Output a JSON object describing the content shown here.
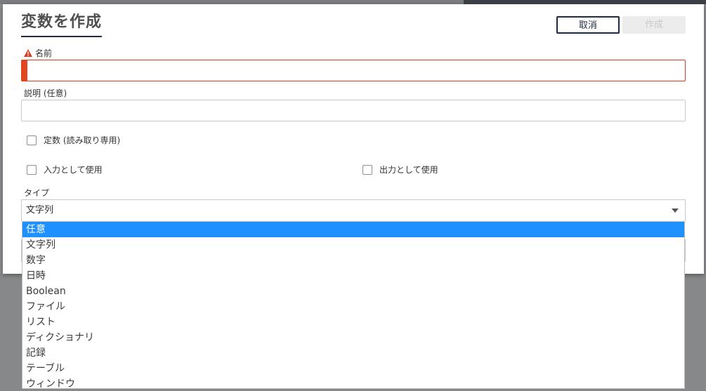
{
  "dialog": {
    "title": "変数を作成",
    "cancel_label": "取消",
    "create_label": "作成"
  },
  "name_field": {
    "label": "名前",
    "value": ""
  },
  "description_field": {
    "label": "説明 (任意)",
    "value": ""
  },
  "checkboxes": {
    "constant": "定数 (読み取り専用)",
    "use_as_input": "入力として使用",
    "use_as_output": "出力として使用"
  },
  "type_field": {
    "label": "タイプ",
    "selected_value": "文字列",
    "options": [
      "任意",
      "文字列",
      "数字",
      "日時",
      "Boolean",
      "ファイル",
      "リスト",
      "ディクショナリ",
      "記録",
      "テーブル",
      "ウィンドウ"
    ],
    "highlighted_option": "任意"
  },
  "colors": {
    "accent_navy": "#1f2a44",
    "error_red": "#e2461f",
    "highlight_blue": "#1e90ff"
  }
}
